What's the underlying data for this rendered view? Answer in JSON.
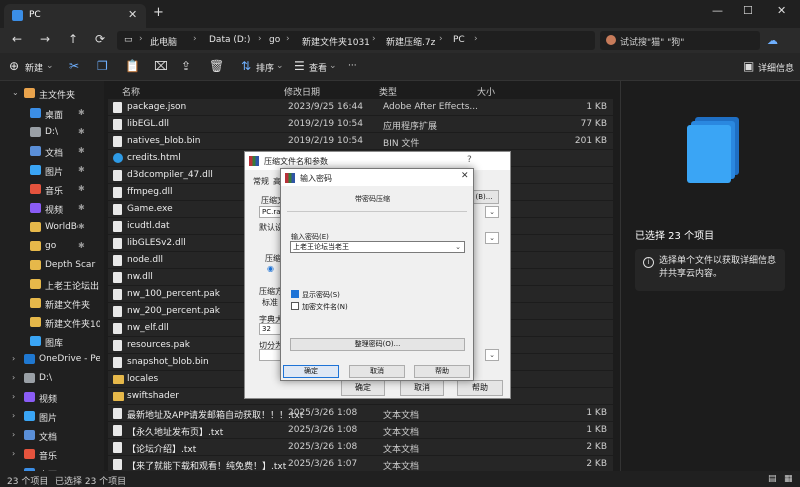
{
  "tab": {
    "title": "PC",
    "close": "✕",
    "add": "+"
  },
  "window_controls": {
    "minimize": "—",
    "maximize": "☐",
    "close": "✕"
  },
  "address": {
    "crumbs": [
      "此电脑",
      "Data (D:)",
      "go",
      "新建文件夹1031",
      "新建压缩.7z",
      "PC"
    ],
    "search_placeholder": "试试搜\"猫\" \"狗\""
  },
  "toolbar": {
    "new": "新建",
    "sort": "排序",
    "view": "查看",
    "more": "···",
    "details": "详细信息"
  },
  "sidebar": {
    "items": [
      {
        "label": "主文件夹",
        "chev": "⌄"
      },
      {
        "label": "桌面",
        "chev": ""
      },
      {
        "label": "D:\\",
        "chev": ""
      },
      {
        "label": "文档",
        "chev": ""
      },
      {
        "label": "图片",
        "chev": ""
      },
      {
        "label": "音乐",
        "chev": ""
      },
      {
        "label": "视频",
        "chev": ""
      },
      {
        "label": "WorldBox",
        "chev": ""
      },
      {
        "label": "go",
        "chev": ""
      },
      {
        "label": "Depth Scar",
        "chev": ""
      },
      {
        "label": "上老王论坛出",
        "chev": ""
      },
      {
        "label": "新建文件夹",
        "chev": ""
      },
      {
        "label": "新建文件夹10:",
        "chev": ""
      },
      {
        "label": "图库",
        "chev": ""
      },
      {
        "label": "OneDrive - Per",
        "chev": "›"
      },
      {
        "label": "D:\\",
        "chev": "›"
      },
      {
        "label": "视频",
        "chev": "›"
      },
      {
        "label": "图片",
        "chev": "›"
      },
      {
        "label": "文档",
        "chev": "›"
      },
      {
        "label": "音乐",
        "chev": "›"
      },
      {
        "label": "桌面",
        "chev": "›"
      }
    ]
  },
  "filelist": {
    "columns": {
      "name": "名称",
      "date": "修改日期",
      "type": "类型",
      "size": "大小"
    },
    "rows": [
      {
        "name": "package.json",
        "date": "2023/9/25 16:44",
        "type": "Adobe After Effects...",
        "size": "1 KB",
        "icon": "file"
      },
      {
        "name": "libEGL.dll",
        "date": "2019/2/19 10:54",
        "type": "应用程序扩展",
        "size": "77 KB",
        "icon": "file"
      },
      {
        "name": "natives_blob.bin",
        "date": "2019/2/19 10:54",
        "type": "BIN 文件",
        "size": "201 KB",
        "icon": "file"
      },
      {
        "name": "credits.html",
        "date": "",
        "type": "",
        "size": "",
        "icon": "html"
      },
      {
        "name": "d3dcompiler_47.dll",
        "date": "",
        "type": "",
        "size": "",
        "icon": "file"
      },
      {
        "name": "ffmpeg.dll",
        "date": "",
        "type": "",
        "size": "",
        "icon": "file"
      },
      {
        "name": "Game.exe",
        "date": "",
        "type": "",
        "size": "",
        "icon": "file"
      },
      {
        "name": "icudtl.dat",
        "date": "",
        "type": "",
        "size": "",
        "icon": "file"
      },
      {
        "name": "libGLESv2.dll",
        "date": "",
        "type": "",
        "size": "",
        "icon": "file"
      },
      {
        "name": "node.dll",
        "date": "",
        "type": "",
        "size": "",
        "icon": "file"
      },
      {
        "name": "nw.dll",
        "date": "",
        "type": "",
        "size": "",
        "icon": "file"
      },
      {
        "name": "nw_100_percent.pak",
        "date": "",
        "type": "",
        "size": "",
        "icon": "file"
      },
      {
        "name": "nw_200_percent.pak",
        "date": "",
        "type": "",
        "size": "",
        "icon": "file"
      },
      {
        "name": "nw_elf.dll",
        "date": "",
        "type": "",
        "size": "",
        "icon": "file"
      },
      {
        "name": "resources.pak",
        "date": "",
        "type": "",
        "size": "",
        "icon": "file"
      },
      {
        "name": "snapshot_blob.bin",
        "date": "",
        "type": "",
        "size": "",
        "icon": "file"
      },
      {
        "name": "locales",
        "date": "",
        "type": "",
        "size": "",
        "icon": "folder"
      },
      {
        "name": "swiftshader",
        "date": "",
        "type": "",
        "size": "",
        "icon": "folder"
      },
      {
        "name": "最新地址及APP请发邮箱自动获取！！！.txt",
        "date": "2025/3/26 1:08",
        "type": "文本文档",
        "size": "1 KB",
        "icon": "file"
      },
      {
        "name": "【永久地址发布页】.txt",
        "date": "2025/3/26 1:08",
        "type": "文本文档",
        "size": "1 KB",
        "icon": "file"
      },
      {
        "name": "【论坛介绍】.txt",
        "date": "2025/3/26 1:08",
        "type": "文本文档",
        "size": "2 KB",
        "icon": "file"
      },
      {
        "name": "【来了就能下载和观看！纯免费！】.txt",
        "date": "2025/3/26 1:07",
        "type": "文本文档",
        "size": "2 KB",
        "icon": "file"
      }
    ]
  },
  "details": {
    "selected": "已选择 23 个项目",
    "info": "选择单个文件以获取详细信息并共享云内容。"
  },
  "status": {
    "count": "23 个项目",
    "selected": "已选择 23 个项目"
  },
  "compress_dialog": {
    "title": "压缩文件名和参数",
    "tab_general": "常规",
    "tab_adv": "高",
    "label_archive": "压缩文",
    "archive_value": "PC.rar",
    "browse": "(B)...",
    "label_default": "默认设",
    "label_format": "压缩文",
    "label_method": "压缩方",
    "method_value": "标准",
    "label_dict": "字典大",
    "dict_value": "32",
    "label_split": "切分为",
    "ok": "确定",
    "cancel": "取消",
    "help": "帮助",
    "q": "?"
  },
  "password_dialog": {
    "title": "输入密码",
    "close": "✕",
    "section": "带密码压缩",
    "label_password": "输入密码(E)",
    "password_value": "上老王论坛当老王",
    "show_password": "显示密码(S)",
    "encrypt_names": "加密文件名(N)",
    "organize": "整理密码(O)...",
    "ok": "确定",
    "cancel": "取消",
    "help": "帮助"
  },
  "colors": {
    "accent": "#3b8ee6",
    "folder": "#e6b84a",
    "bg": "#1c1c1c"
  }
}
